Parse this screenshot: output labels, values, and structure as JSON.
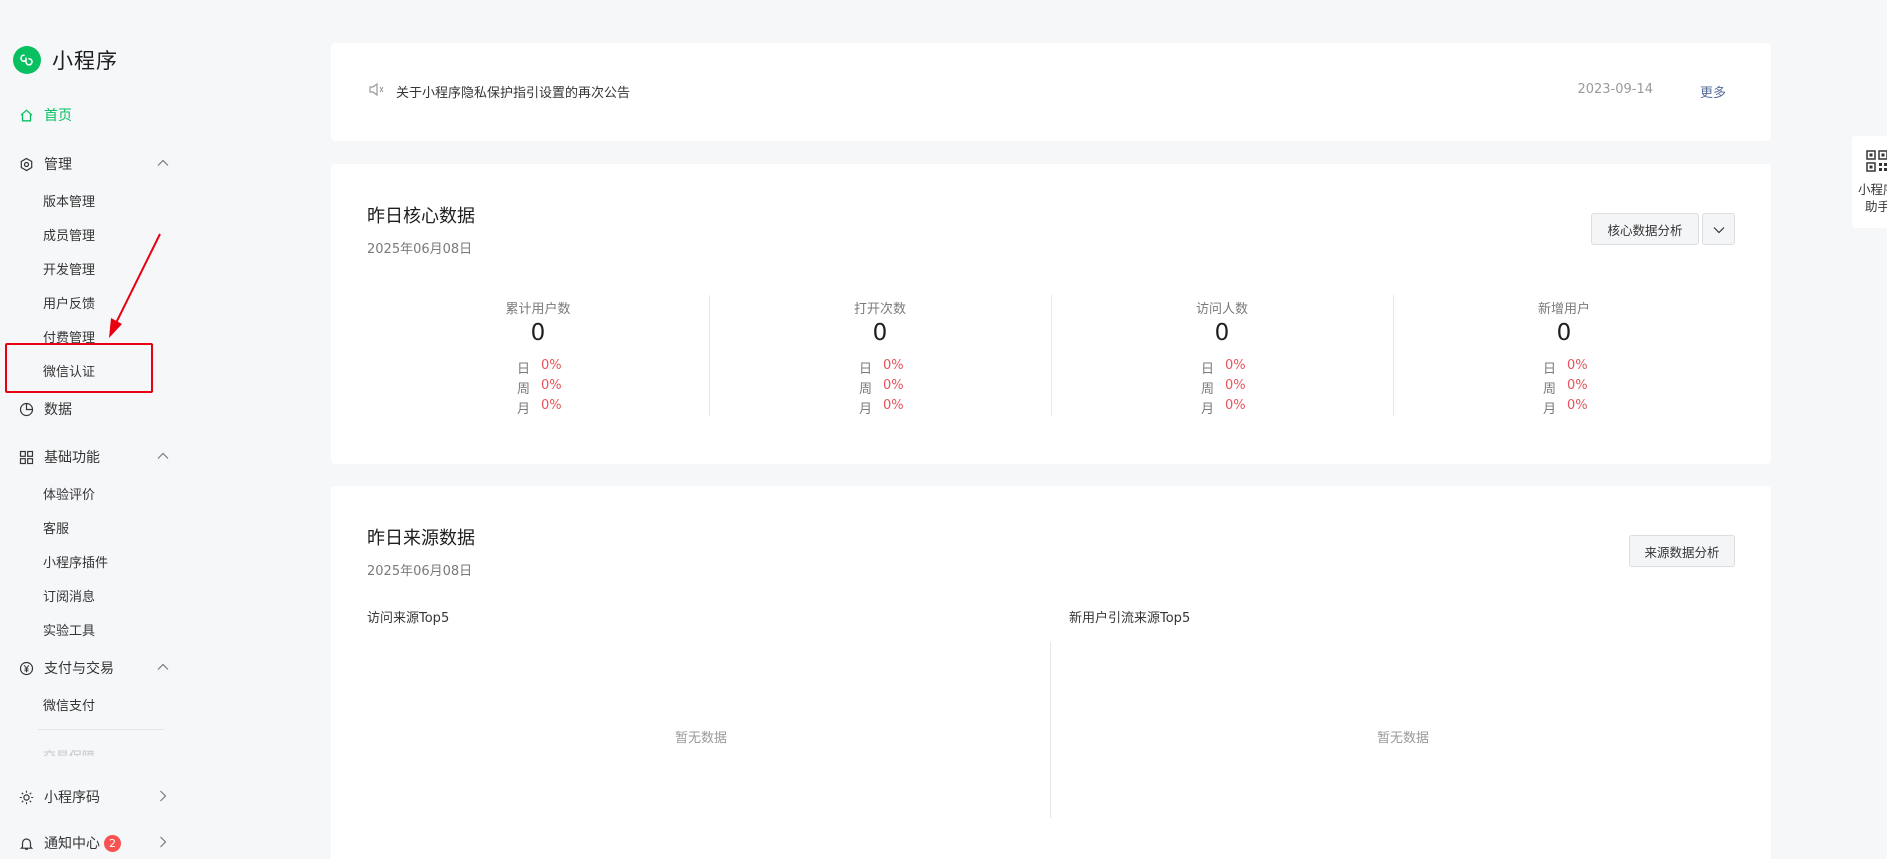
{
  "sidebar": {
    "logo_text": "小程序",
    "home": "首页",
    "manage": {
      "label": "管理",
      "items": [
        "版本管理",
        "成员管理",
        "开发管理",
        "用户反馈",
        "付费管理",
        "微信认证"
      ]
    },
    "data": "数据",
    "basic": {
      "label": "基础功能",
      "items": [
        "体验评价",
        "客服",
        "小程序插件",
        "订阅消息",
        "实验工具"
      ]
    },
    "pay": {
      "label": "支付与交易",
      "items": [
        "微信支付"
      ]
    },
    "faded_item": "交易保障",
    "qrcode": "小程序码",
    "notify": {
      "label": "通知中心",
      "badge": "2"
    }
  },
  "notice": {
    "text": "关于小程序隐私保护指引设置的再次公告",
    "date": "2023-09-14",
    "more": "更多"
  },
  "core": {
    "title": "昨日核心数据",
    "date": "2025年06月08日",
    "analysis_button": "核心数据分析",
    "stats": [
      {
        "label": "累计用户数",
        "value": "0",
        "day_label": "日",
        "day": "0%",
        "week_label": "周",
        "week": "0%",
        "month_label": "月",
        "month": "0%"
      },
      {
        "label": "打开次数",
        "value": "0",
        "day_label": "日",
        "day": "0%",
        "week_label": "周",
        "week": "0%",
        "month_label": "月",
        "month": "0%"
      },
      {
        "label": "访问人数",
        "value": "0",
        "day_label": "日",
        "day": "0%",
        "week_label": "周",
        "week": "0%",
        "month_label": "月",
        "month": "0%"
      },
      {
        "label": "新增用户",
        "value": "0",
        "day_label": "日",
        "day": "0%",
        "week_label": "周",
        "week": "0%",
        "month_label": "月",
        "month": "0%"
      }
    ]
  },
  "source": {
    "title": "昨日来源数据",
    "date": "2025年06月08日",
    "analysis_button": "来源数据分析",
    "left_title": "访问来源Top5",
    "right_title": "新用户引流来源Top5",
    "empty_left": "暂无数据",
    "empty_right": "暂无数据"
  },
  "helper": {
    "line1": "小程序",
    "line2": "助手"
  },
  "colors": {
    "brand": "#07c160",
    "highlight": "#e60012",
    "change": "#e8535b",
    "link": "#576b95"
  }
}
